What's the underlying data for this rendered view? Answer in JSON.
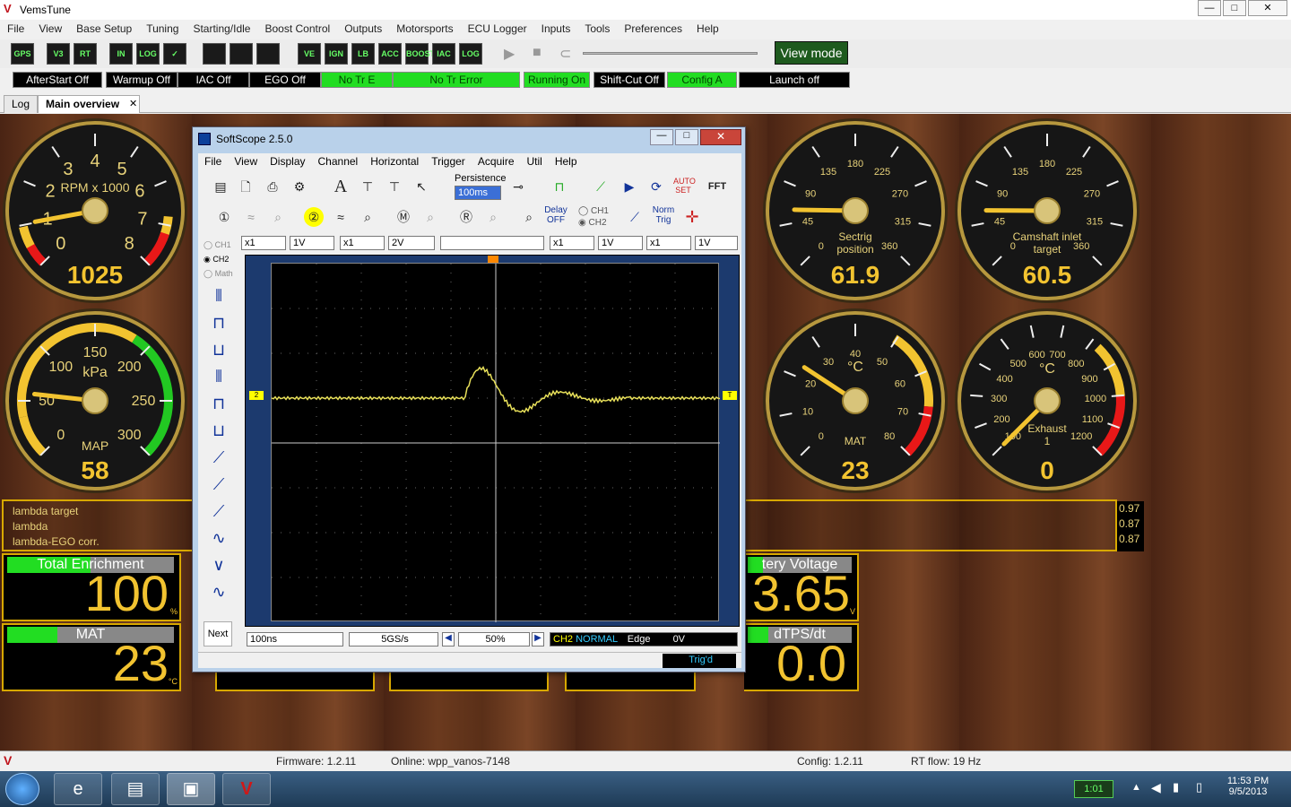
{
  "window": {
    "title": "VemsTune",
    "min": "—",
    "max": "□",
    "close": "✕"
  },
  "menu": [
    "File",
    "View",
    "Base Setup",
    "Tuning",
    "Starting/Idle",
    "Boost Control",
    "Outputs",
    "Motorsports",
    "ECU Logger",
    "Inputs",
    "Tools",
    "Preferences",
    "Help"
  ],
  "toolbar": {
    "buttons": [
      "GPS",
      "V3",
      "RT",
      "IN ECU",
      "LOG",
      "✓",
      "",
      "",
      "",
      "VE",
      "IGN",
      "LB",
      "ACC",
      "BOOST",
      "IAC",
      "LOG VIEW"
    ],
    "view_mode": "View mode"
  },
  "status": [
    {
      "label": "AfterStart Off",
      "on": false
    },
    {
      "label": "Warmup Off",
      "on": false
    },
    {
      "label": "IAC Off",
      "on": false
    },
    {
      "label": "EGO Off",
      "on": false
    },
    {
      "label": "No Tr E",
      "on": true
    },
    {
      "label": "No Tr Error",
      "on": true
    },
    {
      "label": "Running On",
      "on": true
    },
    {
      "label": "Shift-Cut Off",
      "on": false
    },
    {
      "label": "Config A",
      "on": true
    },
    {
      "label": "Launch off",
      "on": false
    }
  ],
  "tabs": {
    "log": "Log",
    "main": "Main overview",
    "close": "✕"
  },
  "gauges": {
    "rpm": {
      "unit": "RPM x 1000",
      "value": "1025",
      "ticks": [
        "0",
        "1",
        "2",
        "3",
        "4",
        "5",
        "6",
        "7",
        "8"
      ],
      "level": 0.128
    },
    "map": {
      "unit": "kPa",
      "title": "MAP",
      "value": "58",
      "ticks": [
        "0",
        "50",
        "100",
        "150",
        "200",
        "250",
        "300"
      ],
      "level": 0.19
    },
    "sectrig": {
      "title": "Sectrig position",
      "value": "61.9",
      "ticks": [
        "0",
        "45",
        "90",
        "135",
        "180",
        "225",
        "270",
        "315",
        "360"
      ],
      "level": 0.17
    },
    "camshaft": {
      "title": "Camshaft inlet target",
      "value": "60.5",
      "ticks": [
        "0",
        "45",
        "90",
        "135",
        "180",
        "225",
        "270",
        "315",
        "360"
      ],
      "level": 0.168
    },
    "mat": {
      "unit": "°C",
      "title": "MAT",
      "value": "23",
      "ticks": [
        "0",
        "10",
        "20",
        "30",
        "40",
        "50",
        "60",
        "70",
        "80"
      ],
      "level": 0.29
    },
    "exhaust": {
      "unit": "°C",
      "title": "Exhaust 1",
      "value": "0",
      "ticks": [
        "100",
        "200",
        "300",
        "400",
        "500",
        "600",
        "700",
        "800",
        "900",
        "1000",
        "1100",
        "1200"
      ],
      "level": 0.0
    }
  },
  "lambda": {
    "labels": [
      "lambda target",
      "lambda",
      "lambda-EGO corr."
    ],
    "values": [
      "0.97",
      "0.87",
      "0.87"
    ]
  },
  "panels": {
    "enrich": {
      "title": "Total Enrichment",
      "value": "100",
      "unit": "%",
      "fill": 0.5
    },
    "mat": {
      "title": "MAT",
      "value": "23",
      "unit": "°C",
      "fill": 0.3
    },
    "battery": {
      "title": "tery Voltage",
      "value": "3.65",
      "unit": "V",
      "fill": 0.15
    },
    "dtps": {
      "title": "dTPS/dt",
      "value": "0.0",
      "unit": "",
      "fill": 0.2
    }
  },
  "scope": {
    "title": "SoftScope 2.5.0",
    "menu": [
      "File",
      "View",
      "Display",
      "Channel",
      "Horizontal",
      "Trigger",
      "Acquire",
      "Util",
      "Help"
    ],
    "persistence": "Persistence",
    "persist_val": "100ms",
    "delay": "Delay OFF",
    "norm": "Norm Trig",
    "ch": [
      "CH1",
      "CH2",
      "Math"
    ],
    "selectors": [
      "x1",
      "1V",
      "x1",
      "2V",
      "x1",
      "1V",
      "x1",
      "1V"
    ],
    "next": "Next",
    "timebase": "100ns",
    "rate": "5GS/s",
    "pos": "50%",
    "trigger": {
      "ch": "CH2",
      "mode": "NORMAL",
      "edge": "Edge",
      "level": "0V"
    },
    "status": "Trig'd",
    "ch2_marker": "2",
    "trig_marker": "T"
  },
  "appstatus": {
    "firmware": "Firmware: 1.2.11",
    "online": "Online: wpp_vanos-7148",
    "config": "Config: 1.2.11",
    "rtflow": "RT flow: 19 Hz"
  },
  "taskbar": {
    "time": "11:53 PM",
    "date": "9/5/2013",
    "battery": "1:01"
  }
}
